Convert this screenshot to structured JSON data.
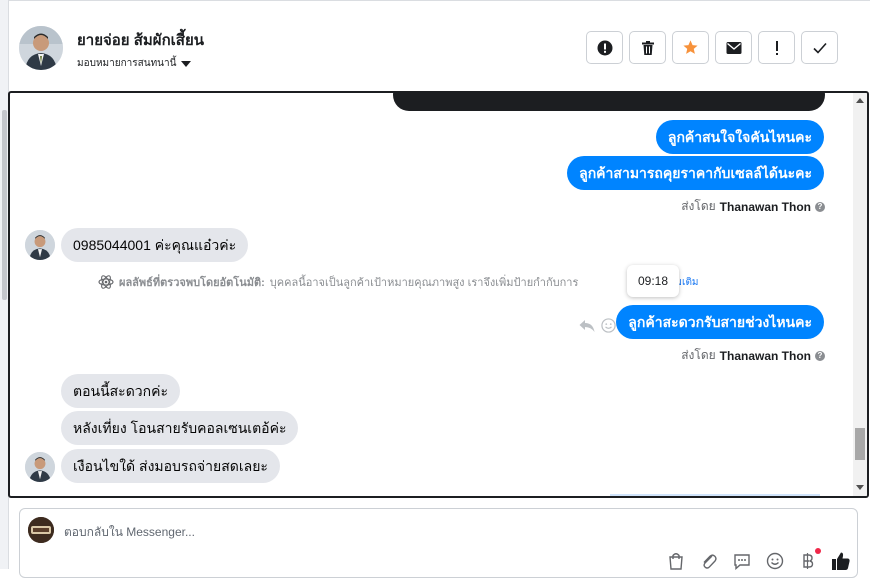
{
  "header": {
    "name": "ยายจ่อย ส้มผักเสี้ยน",
    "assign_label": "มอบหมายการสนทนานี้",
    "actions": [
      {
        "icon": "alert-circle-icon"
      },
      {
        "icon": "trash-icon"
      },
      {
        "icon": "star-icon",
        "color": "#f7923b"
      },
      {
        "icon": "mail-icon"
      },
      {
        "icon": "exclamation-icon"
      },
      {
        "icon": "check-icon"
      }
    ]
  },
  "thread": {
    "messages": {
      "out1": "ลูกค้าสนใจใจคันไหนคะ",
      "out2": "ลูกค้าสามารถคุยราคากับเซลล์ได้นะคะ",
      "in1": "0985044001 ค่ะคุณแอ๋วค่ะ",
      "out3": "ลูกค้าสะดวกรับสายช่วงไหนคะ",
      "in2": "ตอนนี้สะดวกค่ะ",
      "in3": "หลังเที่ยง โอนสายรับคอลเซนเตอ้ค่ะ",
      "in4": "เงือนไขใด้ ส่งมอบรถจ่ายสดเลยะ"
    },
    "sent_by_prefix": "ส่งโดย",
    "sent_by_name": "Thanawan Thon",
    "sent_by_help": "?",
    "ai_notice": {
      "label": "ผลลัพธ์ที่ตรวจพบโดยอัตโนมัติ:",
      "text": "บุคคลนี้อาจเป็นลูกค้าเป้าหมายคุณภาพสูง เราจึงเพิ่มป้ายกำกับการ",
      "tail": "ว้",
      "learn_more": "เรียนรู้เพิ่มเติม"
    },
    "tooltip_time": "09:18"
  },
  "composer": {
    "placeholder": "ตอบกลับใน Messenger...",
    "tools": [
      "shopping-bag-icon",
      "paperclip-icon",
      "saved-reply-icon",
      "emoji-icon",
      "baht-icon",
      "thumbs-up-icon"
    ]
  },
  "colors": {
    "messenger_blue": "#0084ff",
    "incoming_gray": "#e4e6eb",
    "star_orange": "#f7923b",
    "notification_red": "#f02849"
  }
}
